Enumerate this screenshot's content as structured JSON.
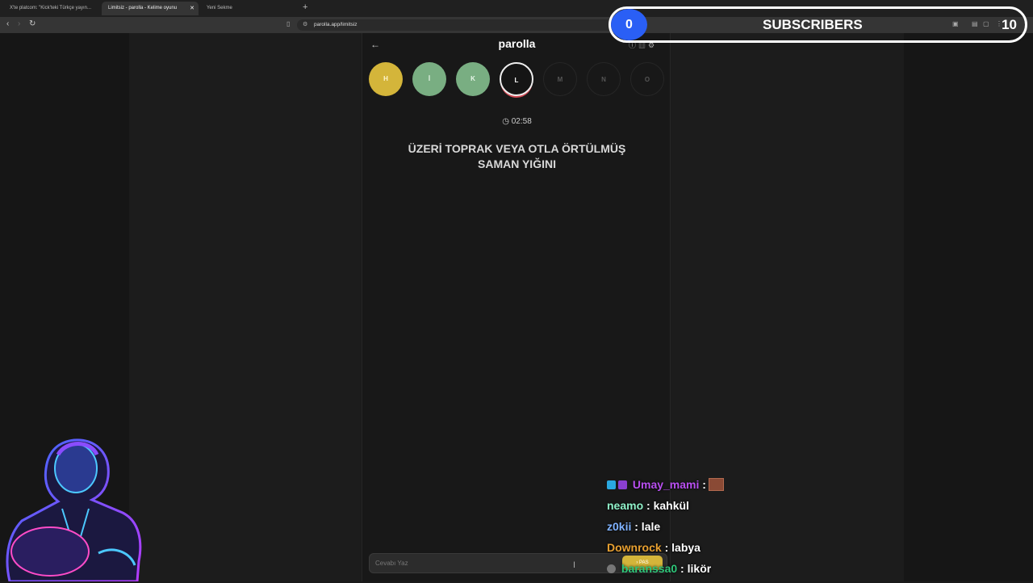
{
  "tabs": [
    {
      "label": "X'te platcom: \"Kick'teki Türkçe yayın...",
      "active": false
    },
    {
      "label": "Limitsiz - parolla - Kelime oyunu",
      "active": true
    },
    {
      "label": "Yeni Sekme",
      "active": false
    }
  ],
  "addressbar": {
    "url": "parolla.app/limitsiz"
  },
  "app": {
    "title": "parolla",
    "letters": [
      {
        "char": "H",
        "state": "gold"
      },
      {
        "char": "İ",
        "state": "green"
      },
      {
        "char": "K",
        "state": "green"
      },
      {
        "char": "L",
        "state": "current"
      },
      {
        "char": "M",
        "state": "future"
      },
      {
        "char": "N",
        "state": "future"
      },
      {
        "char": "O",
        "state": "future"
      }
    ],
    "timer": "02:58",
    "question_line1": "ÜZERİ TOPRAK VEYA OTLA ÖRTÜLMÜŞ",
    "question_line2": "SAMAN YIĞINI",
    "answer_placeholder": "Cevabı Yaz",
    "pass_label": "PAS"
  },
  "overlay": {
    "subscriber_count": "0",
    "subscriber_label": "SUBSCRIBERS",
    "subscriber_goal": "10"
  },
  "chat": [
    {
      "user": "Umay_mami",
      "sep": " :",
      "message": "",
      "color": "#b84ff0",
      "has_badges": true,
      "has_emote": true
    },
    {
      "user": "neamo",
      "sep": " :",
      "message": " kahkül",
      "color": "#8ff0c8",
      "has_badges": false,
      "has_emote": false
    },
    {
      "user": "z0kii",
      "sep": " :",
      "message": " lale",
      "color": "#7fb2ff",
      "has_badges": false,
      "has_emote": false
    },
    {
      "user": "Downrock",
      "sep": " :",
      "message": " labya",
      "color": "#e8a030",
      "has_badges": false,
      "has_emote": false
    },
    {
      "user": "baranssa0",
      "sep": " :",
      "message": " likör",
      "color": "#2fc77a",
      "has_badges": true,
      "has_emote": false
    }
  ]
}
